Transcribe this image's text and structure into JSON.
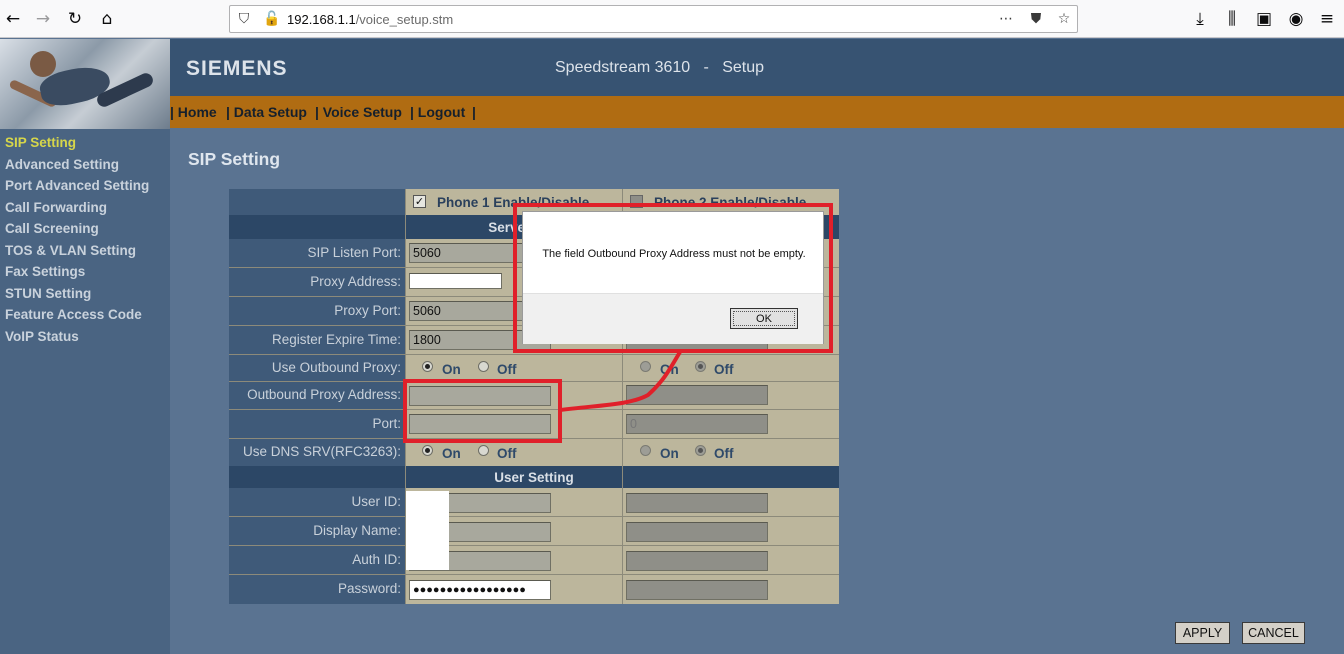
{
  "browser": {
    "url_host": "192.168.1.1",
    "url_path": "/voice_setup.stm",
    "icons": [
      "back-arrow-icon",
      "forward-arrow-icon",
      "reload-icon",
      "home-icon",
      "shield-icon",
      "insecure-lock-icon",
      "more-dots-icon",
      "pocket-icon",
      "star-icon",
      "download-icon",
      "library-icon",
      "sidebar-icon",
      "account-icon",
      "menu-icon"
    ]
  },
  "header": {
    "brand": "SIEMENS",
    "model": "Speedstream 3610   -   Setup"
  },
  "nav": {
    "items": [
      "| Home",
      "| Data Setup",
      "| Voice Setup",
      "| Logout",
      "|"
    ]
  },
  "sidebar": {
    "items": [
      "SIP Setting",
      "Advanced Setting",
      "Port Advanced Setting",
      "Call Forwarding",
      "Call Screening",
      "TOS & VLAN Setting",
      "Fax Settings",
      "STUN Setting",
      "Feature Access Code",
      "VoIP Status"
    ],
    "active": "SIP Setting"
  },
  "page": {
    "title": "SIP Setting"
  },
  "table": {
    "phone1_header": "Phone 1 Enable/Disable",
    "phone2_header": "Phone 2 Enable/Disable",
    "phone1_enabled": true,
    "phone2_enabled": false,
    "server_section": "Server Setting",
    "user_section": "User Setting",
    "labels": {
      "sip_listen_port": "SIP Listen Port:",
      "proxy_address": "Proxy Address:",
      "proxy_port": "Proxy Port:",
      "register_expire": "Register Expire Time:",
      "use_outbound_proxy": "Use Outbound Proxy:",
      "outbound_proxy_address": "Outbound Proxy Address:",
      "port": "Port:",
      "use_dns_srv": "Use DNS SRV(RFC3263):",
      "user_id": "User ID:",
      "display_name": "Display Name:",
      "auth_id": "Auth ID:",
      "password": "Password:"
    },
    "phone1": {
      "sip_listen_port": "5060",
      "proxy_address": "",
      "proxy_port": "5060",
      "register_expire": "1800",
      "outbound_proxy_address": "",
      "port": "",
      "password": "●●●●●●●●●●●●●●●●●"
    },
    "phone2": {
      "port": "0"
    },
    "radio": {
      "on": "On",
      "off": "Off"
    }
  },
  "buttons": {
    "apply": "APPLY",
    "cancel": "CANCEL"
  },
  "dialog": {
    "message": "The field Outbound Proxy Address must not be empty.",
    "ok": "OK"
  },
  "colors": {
    "annotation_red": "#e0202a",
    "nav_orange": "#b06c12",
    "header_blue": "#375372",
    "active_sidebar": "#d6d64a"
  }
}
